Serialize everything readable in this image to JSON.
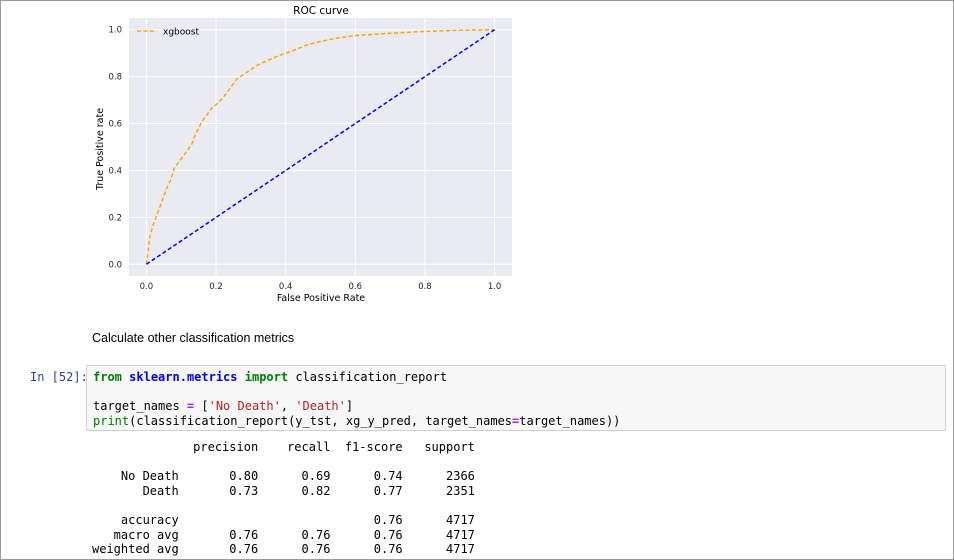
{
  "chart_data": {
    "type": "line",
    "title": "ROC curve",
    "xlabel": "False Positive Rate",
    "ylabel": "True Positive rate",
    "xlim": [
      -0.05,
      1.05
    ],
    "ylim": [
      -0.05,
      1.05
    ],
    "xticks": [
      "0.0",
      "0.2",
      "0.4",
      "0.6",
      "0.8",
      "1.0"
    ],
    "yticks": [
      "0.0",
      "0.2",
      "0.4",
      "0.6",
      "0.8",
      "1.0"
    ],
    "grid": true,
    "legend": "top-left",
    "series": [
      {
        "name": "xgboost",
        "color": "#ffa500",
        "style": "dashed",
        "x": [
          0.0,
          0.01,
          0.02,
          0.03,
          0.04,
          0.05,
          0.06,
          0.07,
          0.08,
          0.09,
          0.1,
          0.11,
          0.12,
          0.13,
          0.14,
          0.15,
          0.16,
          0.17,
          0.18,
          0.19,
          0.2,
          0.22,
          0.24,
          0.26,
          0.28,
          0.3,
          0.32,
          0.35,
          0.38,
          0.42,
          0.46,
          0.5,
          0.55,
          0.6,
          0.7,
          0.8,
          0.9,
          1.0
        ],
        "y": [
          0.0,
          0.12,
          0.17,
          0.21,
          0.25,
          0.29,
          0.33,
          0.36,
          0.41,
          0.43,
          0.45,
          0.47,
          0.49,
          0.51,
          0.55,
          0.58,
          0.61,
          0.63,
          0.65,
          0.67,
          0.68,
          0.71,
          0.75,
          0.79,
          0.81,
          0.83,
          0.85,
          0.87,
          0.89,
          0.91,
          0.935,
          0.95,
          0.965,
          0.975,
          0.985,
          0.993,
          0.998,
          1.0
        ]
      },
      {
        "name": "",
        "color": "#0000ff",
        "style": "dashed",
        "x": [
          0.0,
          1.0
        ],
        "y": [
          0.0,
          1.0
        ]
      }
    ]
  },
  "markdown": {
    "text": "Calculate other classification metrics"
  },
  "cell": {
    "prompt": "In [52]:",
    "code": {
      "l1_from": "from",
      "l1_module": "sklearn.metrics",
      "l1_import": "import",
      "l1_name": " classification_report",
      "l3_pre": "target_names ",
      "l3_eq": "=",
      "l3_open": " [",
      "l3_s1": "'No Death'",
      "l3_sep": ", ",
      "l3_s2": "'Death'",
      "l3_close": "]",
      "l4_print": "print",
      "l4_a": "(classification_report(y_tst, xg_y_pred, target_names",
      "l4_eq": "=",
      "l4_b": "target_names))"
    }
  },
  "output": {
    "lines": [
      "              precision    recall  f1-score   support",
      "",
      "    No Death       0.80      0.69      0.74      2366",
      "       Death       0.73      0.82      0.77      2351",
      "",
      "    accuracy                           0.76      4717",
      "   macro avg       0.76      0.76      0.76      4717",
      "weighted avg       0.76      0.76      0.76      4717"
    ]
  }
}
